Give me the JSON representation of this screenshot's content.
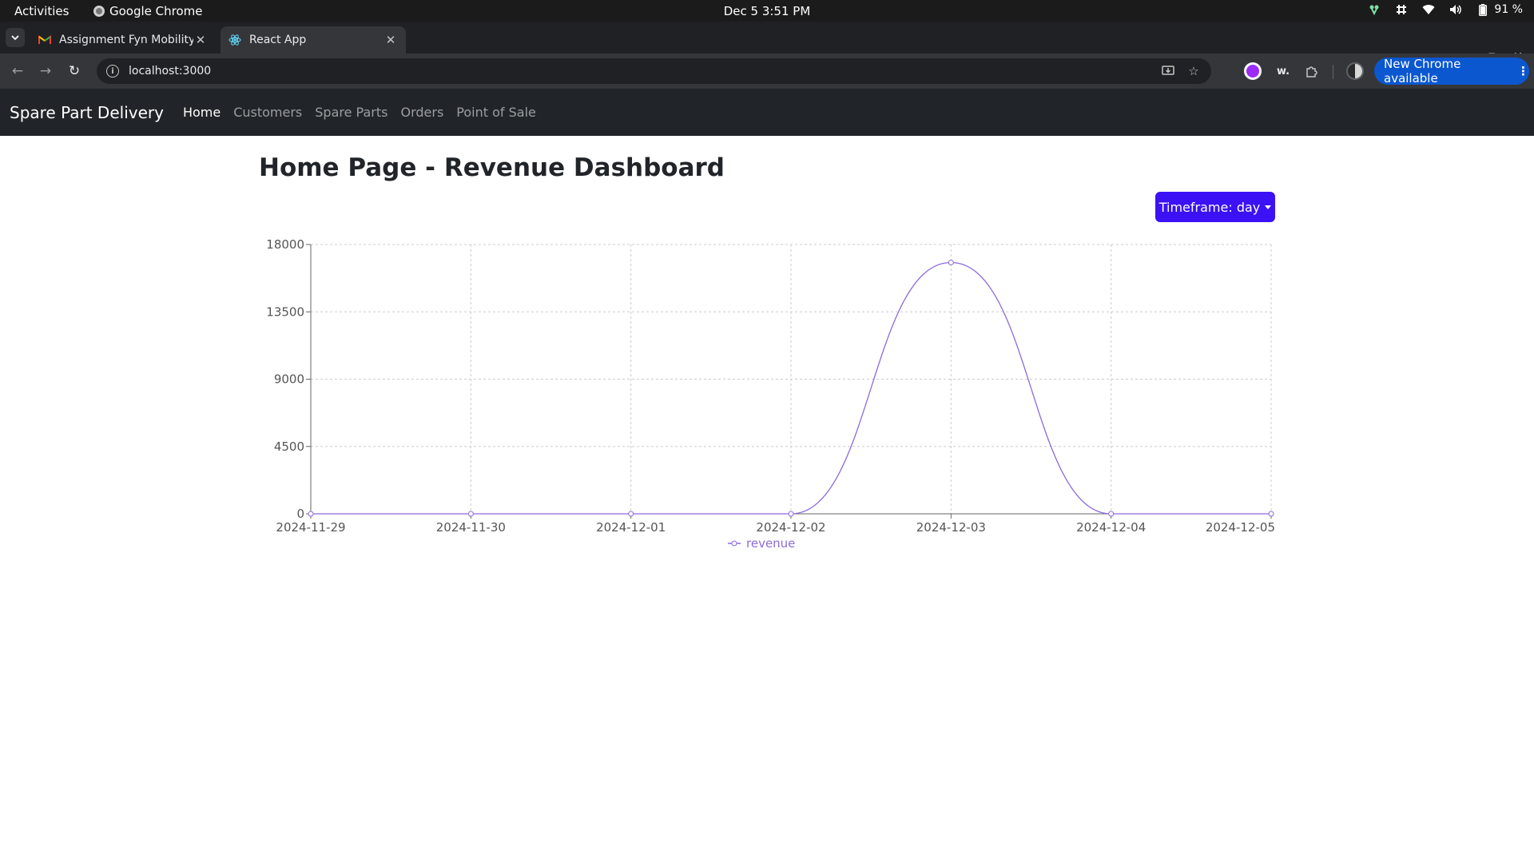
{
  "system_bar": {
    "activities": "Activities",
    "app_name": "Google Chrome",
    "clock": "Dec 5  3:51 PM",
    "battery": "91 %"
  },
  "browser": {
    "tabs": [
      {
        "title": "Assignment Fyn Mobility",
        "favicon": "gmail-icon"
      },
      {
        "title": "React App",
        "favicon": "react-icon",
        "active": true
      }
    ],
    "address": "localhost:3000",
    "update_label": "New Chrome available",
    "extension_w": "w."
  },
  "navbar": {
    "brand": "Spare Part Delivery",
    "links": [
      "Home",
      "Customers",
      "Spare Parts",
      "Orders",
      "Point of Sale"
    ]
  },
  "page": {
    "title": "Home Page - Revenue Dashboard",
    "timeframe_label": "Timeframe: day"
  },
  "chart_data": {
    "type": "line",
    "x": [
      "2024-11-29",
      "2024-11-30",
      "2024-12-01",
      "2024-12-02",
      "2024-12-03",
      "2024-12-04",
      "2024-12-05"
    ],
    "series": [
      {
        "name": "revenue",
        "values": [
          0,
          0,
          0,
          0,
          16800,
          0,
          0
        ],
        "color": "#8d6bdc"
      }
    ],
    "y_ticks": [
      0,
      4500,
      9000,
      13500,
      18000
    ],
    "ylim": [
      0,
      18000
    ],
    "grid": true,
    "curve": "smooth",
    "legend_position": "bottom-center",
    "axis_color": "#666666"
  }
}
